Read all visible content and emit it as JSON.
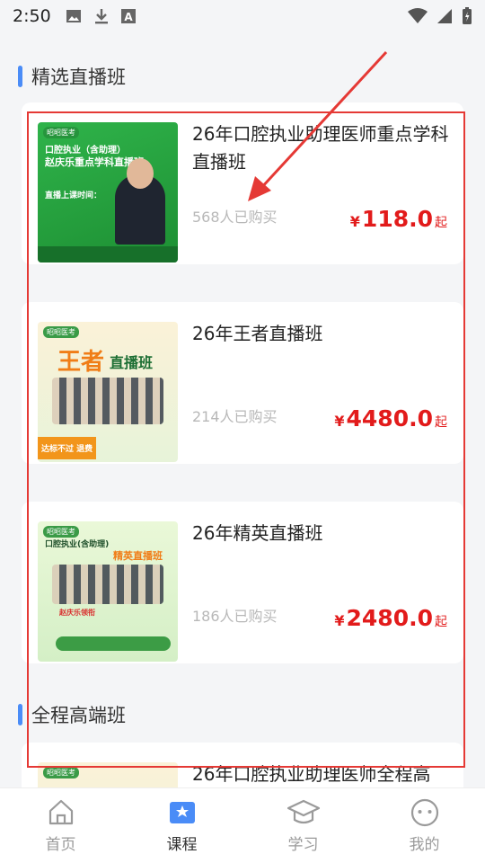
{
  "status_bar": {
    "time": "2:50",
    "icons": [
      "image-icon",
      "download-icon",
      "a-icon"
    ],
    "right_icons": [
      "wifi-icon",
      "signal-icon",
      "battery-icon"
    ]
  },
  "sections": [
    {
      "title": "精选直播班"
    },
    {
      "title": "全程高端班"
    }
  ],
  "courses": [
    {
      "title": "26年口腔执业助理医师重点学科直播班",
      "buyers": "568人已购买",
      "currency": "¥",
      "price": "118.0",
      "price_suffix": "起",
      "thumb": {
        "brand": "昭昭医考",
        "headline": "口腔执业（含助理）",
        "sub": "赵庆乐重点学科直播班",
        "note": "直播上课时间："
      }
    },
    {
      "title": "26年王者直播班",
      "buyers": "214人已购买",
      "currency": "¥",
      "price": "4480.0",
      "price_suffix": "起",
      "thumb": {
        "brand": "昭昭医考",
        "headline": "王者",
        "sub": "直播班",
        "note": "达标不过 退费"
      }
    },
    {
      "title": "26年精英直播班",
      "buyers": "186人已购买",
      "currency": "¥",
      "price": "2480.0",
      "price_suffix": "起",
      "thumb": {
        "brand": "昭昭医考",
        "headline": "口腔执业(含助理)",
        "sub": "精英直播班",
        "note": "赵庆乐领衔"
      }
    },
    {
      "title": "26年口腔执业助理医师全程高",
      "thumb": {
        "brand": "昭昭医考"
      }
    }
  ],
  "tabs": [
    {
      "label": "首页",
      "icon": "home-icon",
      "active": false
    },
    {
      "label": "课程",
      "icon": "course-icon",
      "active": true
    },
    {
      "label": "学习",
      "icon": "graduation-cap-icon",
      "active": false
    },
    {
      "label": "我的",
      "icon": "profile-face-icon",
      "active": false
    }
  ],
  "colors": {
    "accent": "#4a8cf7",
    "price": "#e21b1b",
    "annotation": "#e53935"
  }
}
